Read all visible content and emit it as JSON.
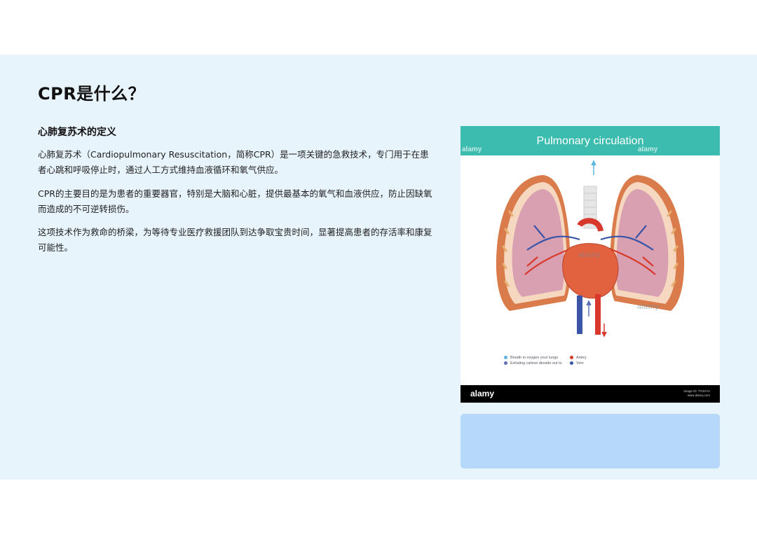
{
  "slide": {
    "title": "CPR是什么？",
    "subtitle": "心肺复苏术的定义",
    "paragraphs": [
      "心肺复苏术（Cardiopulmonary Resuscitation，简称CPR）是一项关键的急救技术，专门用于在患者心跳和呼吸停止时，通过人工方式维持血液循环和氧气供应。",
      "CPR的主要目的是为患者的重要器官，特别是大脑和心脏，提供最基本的氧气和血液供应，防止因缺氧而造成的不可逆转损伤。",
      "这项技术作为救命的桥梁，为等待专业医疗救援团队到达争取宝贵时间，显著提高患者的存活率和康复可能性。"
    ]
  },
  "figure": {
    "title": "Pulmonary circulation",
    "watermark": "alamy",
    "legend": [
      {
        "label": "Breath in oxygen your lungs",
        "color": "#5ab6e0"
      },
      {
        "label": "Exhaling carbon dioxide out to",
        "color": "#5a6fb5"
      },
      {
        "label": "Artery",
        "color": "#d9382c"
      },
      {
        "label": "Vein",
        "color": "#3a55a8"
      }
    ],
    "footer_logo": "alamy",
    "footer_id": "Image ID: TX3XYA",
    "footer_url": "www.alamy.com"
  }
}
